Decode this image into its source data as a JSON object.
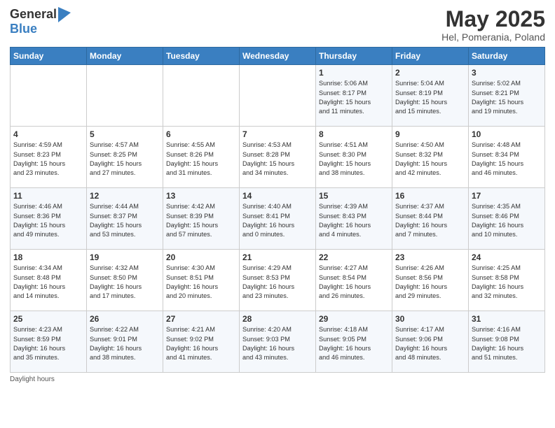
{
  "header": {
    "logo_line1": "General",
    "logo_line2": "Blue",
    "month": "May 2025",
    "location": "Hel, Pomerania, Poland"
  },
  "days_of_week": [
    "Sunday",
    "Monday",
    "Tuesday",
    "Wednesday",
    "Thursday",
    "Friday",
    "Saturday"
  ],
  "weeks": [
    [
      {
        "num": "",
        "info": ""
      },
      {
        "num": "",
        "info": ""
      },
      {
        "num": "",
        "info": ""
      },
      {
        "num": "",
        "info": ""
      },
      {
        "num": "1",
        "info": "Sunrise: 5:06 AM\nSunset: 8:17 PM\nDaylight: 15 hours\nand 11 minutes."
      },
      {
        "num": "2",
        "info": "Sunrise: 5:04 AM\nSunset: 8:19 PM\nDaylight: 15 hours\nand 15 minutes."
      },
      {
        "num": "3",
        "info": "Sunrise: 5:02 AM\nSunset: 8:21 PM\nDaylight: 15 hours\nand 19 minutes."
      }
    ],
    [
      {
        "num": "4",
        "info": "Sunrise: 4:59 AM\nSunset: 8:23 PM\nDaylight: 15 hours\nand 23 minutes."
      },
      {
        "num": "5",
        "info": "Sunrise: 4:57 AM\nSunset: 8:25 PM\nDaylight: 15 hours\nand 27 minutes."
      },
      {
        "num": "6",
        "info": "Sunrise: 4:55 AM\nSunset: 8:26 PM\nDaylight: 15 hours\nand 31 minutes."
      },
      {
        "num": "7",
        "info": "Sunrise: 4:53 AM\nSunset: 8:28 PM\nDaylight: 15 hours\nand 34 minutes."
      },
      {
        "num": "8",
        "info": "Sunrise: 4:51 AM\nSunset: 8:30 PM\nDaylight: 15 hours\nand 38 minutes."
      },
      {
        "num": "9",
        "info": "Sunrise: 4:50 AM\nSunset: 8:32 PM\nDaylight: 15 hours\nand 42 minutes."
      },
      {
        "num": "10",
        "info": "Sunrise: 4:48 AM\nSunset: 8:34 PM\nDaylight: 15 hours\nand 46 minutes."
      }
    ],
    [
      {
        "num": "11",
        "info": "Sunrise: 4:46 AM\nSunset: 8:36 PM\nDaylight: 15 hours\nand 49 minutes."
      },
      {
        "num": "12",
        "info": "Sunrise: 4:44 AM\nSunset: 8:37 PM\nDaylight: 15 hours\nand 53 minutes."
      },
      {
        "num": "13",
        "info": "Sunrise: 4:42 AM\nSunset: 8:39 PM\nDaylight: 15 hours\nand 57 minutes."
      },
      {
        "num": "14",
        "info": "Sunrise: 4:40 AM\nSunset: 8:41 PM\nDaylight: 16 hours\nand 0 minutes."
      },
      {
        "num": "15",
        "info": "Sunrise: 4:39 AM\nSunset: 8:43 PM\nDaylight: 16 hours\nand 4 minutes."
      },
      {
        "num": "16",
        "info": "Sunrise: 4:37 AM\nSunset: 8:44 PM\nDaylight: 16 hours\nand 7 minutes."
      },
      {
        "num": "17",
        "info": "Sunrise: 4:35 AM\nSunset: 8:46 PM\nDaylight: 16 hours\nand 10 minutes."
      }
    ],
    [
      {
        "num": "18",
        "info": "Sunrise: 4:34 AM\nSunset: 8:48 PM\nDaylight: 16 hours\nand 14 minutes."
      },
      {
        "num": "19",
        "info": "Sunrise: 4:32 AM\nSunset: 8:50 PM\nDaylight: 16 hours\nand 17 minutes."
      },
      {
        "num": "20",
        "info": "Sunrise: 4:30 AM\nSunset: 8:51 PM\nDaylight: 16 hours\nand 20 minutes."
      },
      {
        "num": "21",
        "info": "Sunrise: 4:29 AM\nSunset: 8:53 PM\nDaylight: 16 hours\nand 23 minutes."
      },
      {
        "num": "22",
        "info": "Sunrise: 4:27 AM\nSunset: 8:54 PM\nDaylight: 16 hours\nand 26 minutes."
      },
      {
        "num": "23",
        "info": "Sunrise: 4:26 AM\nSunset: 8:56 PM\nDaylight: 16 hours\nand 29 minutes."
      },
      {
        "num": "24",
        "info": "Sunrise: 4:25 AM\nSunset: 8:58 PM\nDaylight: 16 hours\nand 32 minutes."
      }
    ],
    [
      {
        "num": "25",
        "info": "Sunrise: 4:23 AM\nSunset: 8:59 PM\nDaylight: 16 hours\nand 35 minutes."
      },
      {
        "num": "26",
        "info": "Sunrise: 4:22 AM\nSunset: 9:01 PM\nDaylight: 16 hours\nand 38 minutes."
      },
      {
        "num": "27",
        "info": "Sunrise: 4:21 AM\nSunset: 9:02 PM\nDaylight: 16 hours\nand 41 minutes."
      },
      {
        "num": "28",
        "info": "Sunrise: 4:20 AM\nSunset: 9:03 PM\nDaylight: 16 hours\nand 43 minutes."
      },
      {
        "num": "29",
        "info": "Sunrise: 4:18 AM\nSunset: 9:05 PM\nDaylight: 16 hours\nand 46 minutes."
      },
      {
        "num": "30",
        "info": "Sunrise: 4:17 AM\nSunset: 9:06 PM\nDaylight: 16 hours\nand 48 minutes."
      },
      {
        "num": "31",
        "info": "Sunrise: 4:16 AM\nSunset: 9:08 PM\nDaylight: 16 hours\nand 51 minutes."
      }
    ]
  ],
  "footer": {
    "daylight_label": "Daylight hours"
  }
}
